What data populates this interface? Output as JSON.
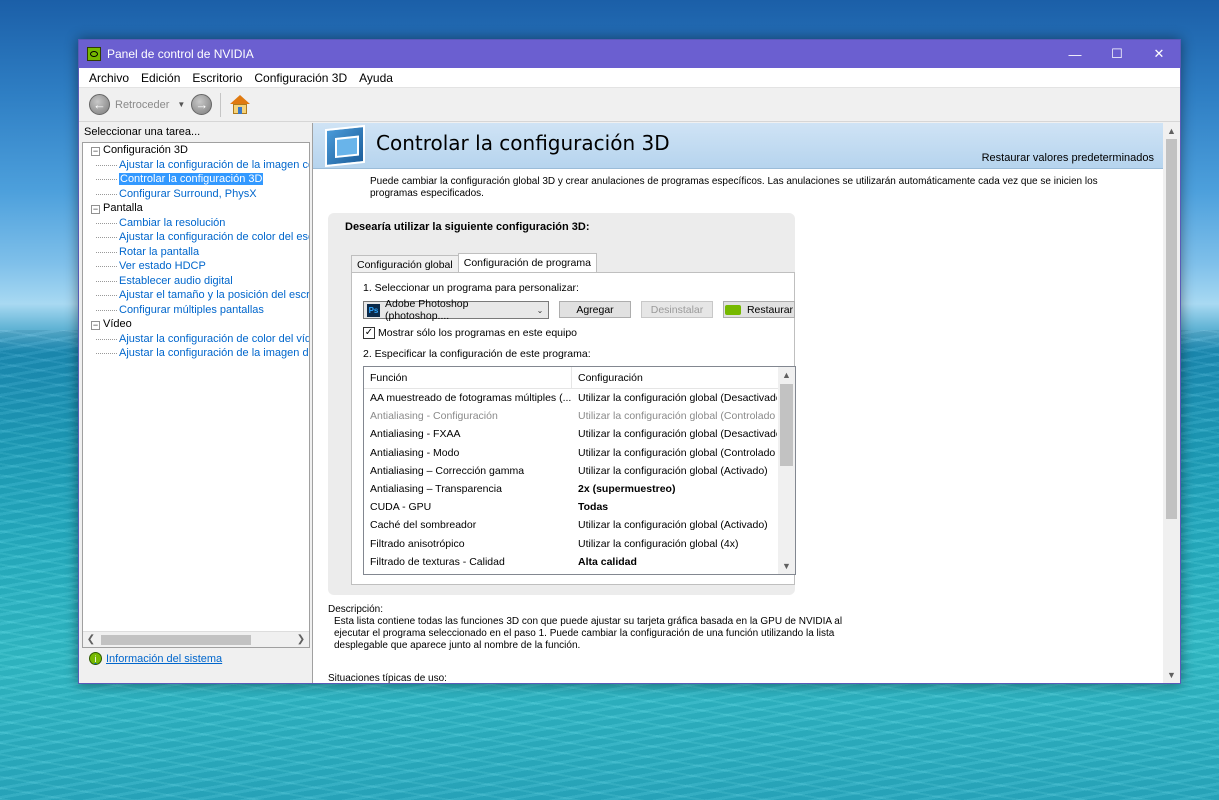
{
  "window": {
    "title": "Panel de control de NVIDIA",
    "controls": {
      "minimize": "—",
      "maximize": "☐",
      "close": "✕"
    }
  },
  "menu": [
    "Archivo",
    "Edición",
    "Escritorio",
    "Configuración 3D",
    "Ayuda"
  ],
  "toolbar": {
    "back_label": "Retroceder"
  },
  "left": {
    "header": "Seleccionar una tarea...",
    "tree": [
      {
        "kind": "cat",
        "label": "Configuración 3D"
      },
      {
        "kind": "item",
        "label": "Ajustar la configuración de la imagen con vista previa"
      },
      {
        "kind": "item",
        "label": "Controlar la configuración 3D",
        "selected": true
      },
      {
        "kind": "item",
        "label": "Configurar Surround, PhysX"
      },
      {
        "kind": "cat",
        "label": "Pantalla"
      },
      {
        "kind": "item",
        "label": "Cambiar la resolución"
      },
      {
        "kind": "item",
        "label": "Ajustar la configuración de color del escritorio"
      },
      {
        "kind": "item",
        "label": "Rotar la pantalla"
      },
      {
        "kind": "item",
        "label": "Ver estado HDCP"
      },
      {
        "kind": "item",
        "label": "Establecer audio digital"
      },
      {
        "kind": "item",
        "label": "Ajustar el tamaño y la posición del escritorio"
      },
      {
        "kind": "item",
        "label": "Configurar múltiples pantallas"
      },
      {
        "kind": "cat",
        "label": "Vídeo"
      },
      {
        "kind": "item",
        "label": "Ajustar la configuración de color del vídeo"
      },
      {
        "kind": "item",
        "label": "Ajustar la configuración de la imagen de vídeo"
      }
    ],
    "sysinfo": "Información del sistema"
  },
  "main": {
    "title": "Controlar la configuración 3D",
    "restore_defaults": "Restaurar valores predeterminados",
    "intro": "Puede cambiar la configuración global 3D y crear anulaciones de programas específicos. Las anulaciones se utilizarán automáticamente cada vez que se inicien los programas especificados.",
    "question": "Desearía utilizar la siguiente configuración 3D:",
    "tabs": [
      "Configuración global",
      "Configuración de programa"
    ],
    "step1": "1. Seleccionar un programa para personalizar:",
    "program": "Adobe Photoshop (photoshop....",
    "btn_add": "Agregar",
    "btn_uninstall": "Desinstalar",
    "btn_restore": "Restaurar",
    "checkbox": "Mostrar sólo los programas en este equipo",
    "checkbox_checked": true,
    "step2": "2. Especificar la configuración de este programa:",
    "grid_headers": [
      "Función",
      "Configuración"
    ],
    "grid_rows": [
      {
        "f": "AA muestreado de fotogramas múltiples (...",
        "c": "Utilizar la configuración global (Desactivado)"
      },
      {
        "f": "Antialiasing - Configuración",
        "c": "Utilizar la configuración global (Controlado ...",
        "gray": true
      },
      {
        "f": "Antialiasing - FXAA",
        "c": "Utilizar la configuración global (Desactivado)"
      },
      {
        "f": "Antialiasing - Modo",
        "c": "Utilizar la configuración global (Controlado ..."
      },
      {
        "f": "Antialiasing – Corrección gamma",
        "c": "Utilizar la configuración global (Activado)"
      },
      {
        "f": "Antialiasing – Transparencia",
        "c": "2x (supermuestreo)",
        "bold": true
      },
      {
        "f": "CUDA - GPU",
        "c": "Todas",
        "bold": true
      },
      {
        "f": "Caché del sombreador",
        "c": "Utilizar la configuración global (Activado)"
      },
      {
        "f": "Filtrado anisotrópico",
        "c": "Utilizar la configuración global (4x)"
      },
      {
        "f": "Filtrado de texturas - Calidad",
        "c": "Alta calidad",
        "bold": true
      }
    ],
    "desc_label": "Descripción:",
    "desc_body": "Esta lista contiene todas las funciones 3D con que puede ajustar su tarjeta gráfica basada en la GPU de NVIDIA al ejecutar el programa seleccionado en el paso 1. Puede cambiar la configuración de una función utilizando la lista desplegable que aparece junto al nombre de la función.",
    "situations": "Situaciones típicas de uso:"
  }
}
